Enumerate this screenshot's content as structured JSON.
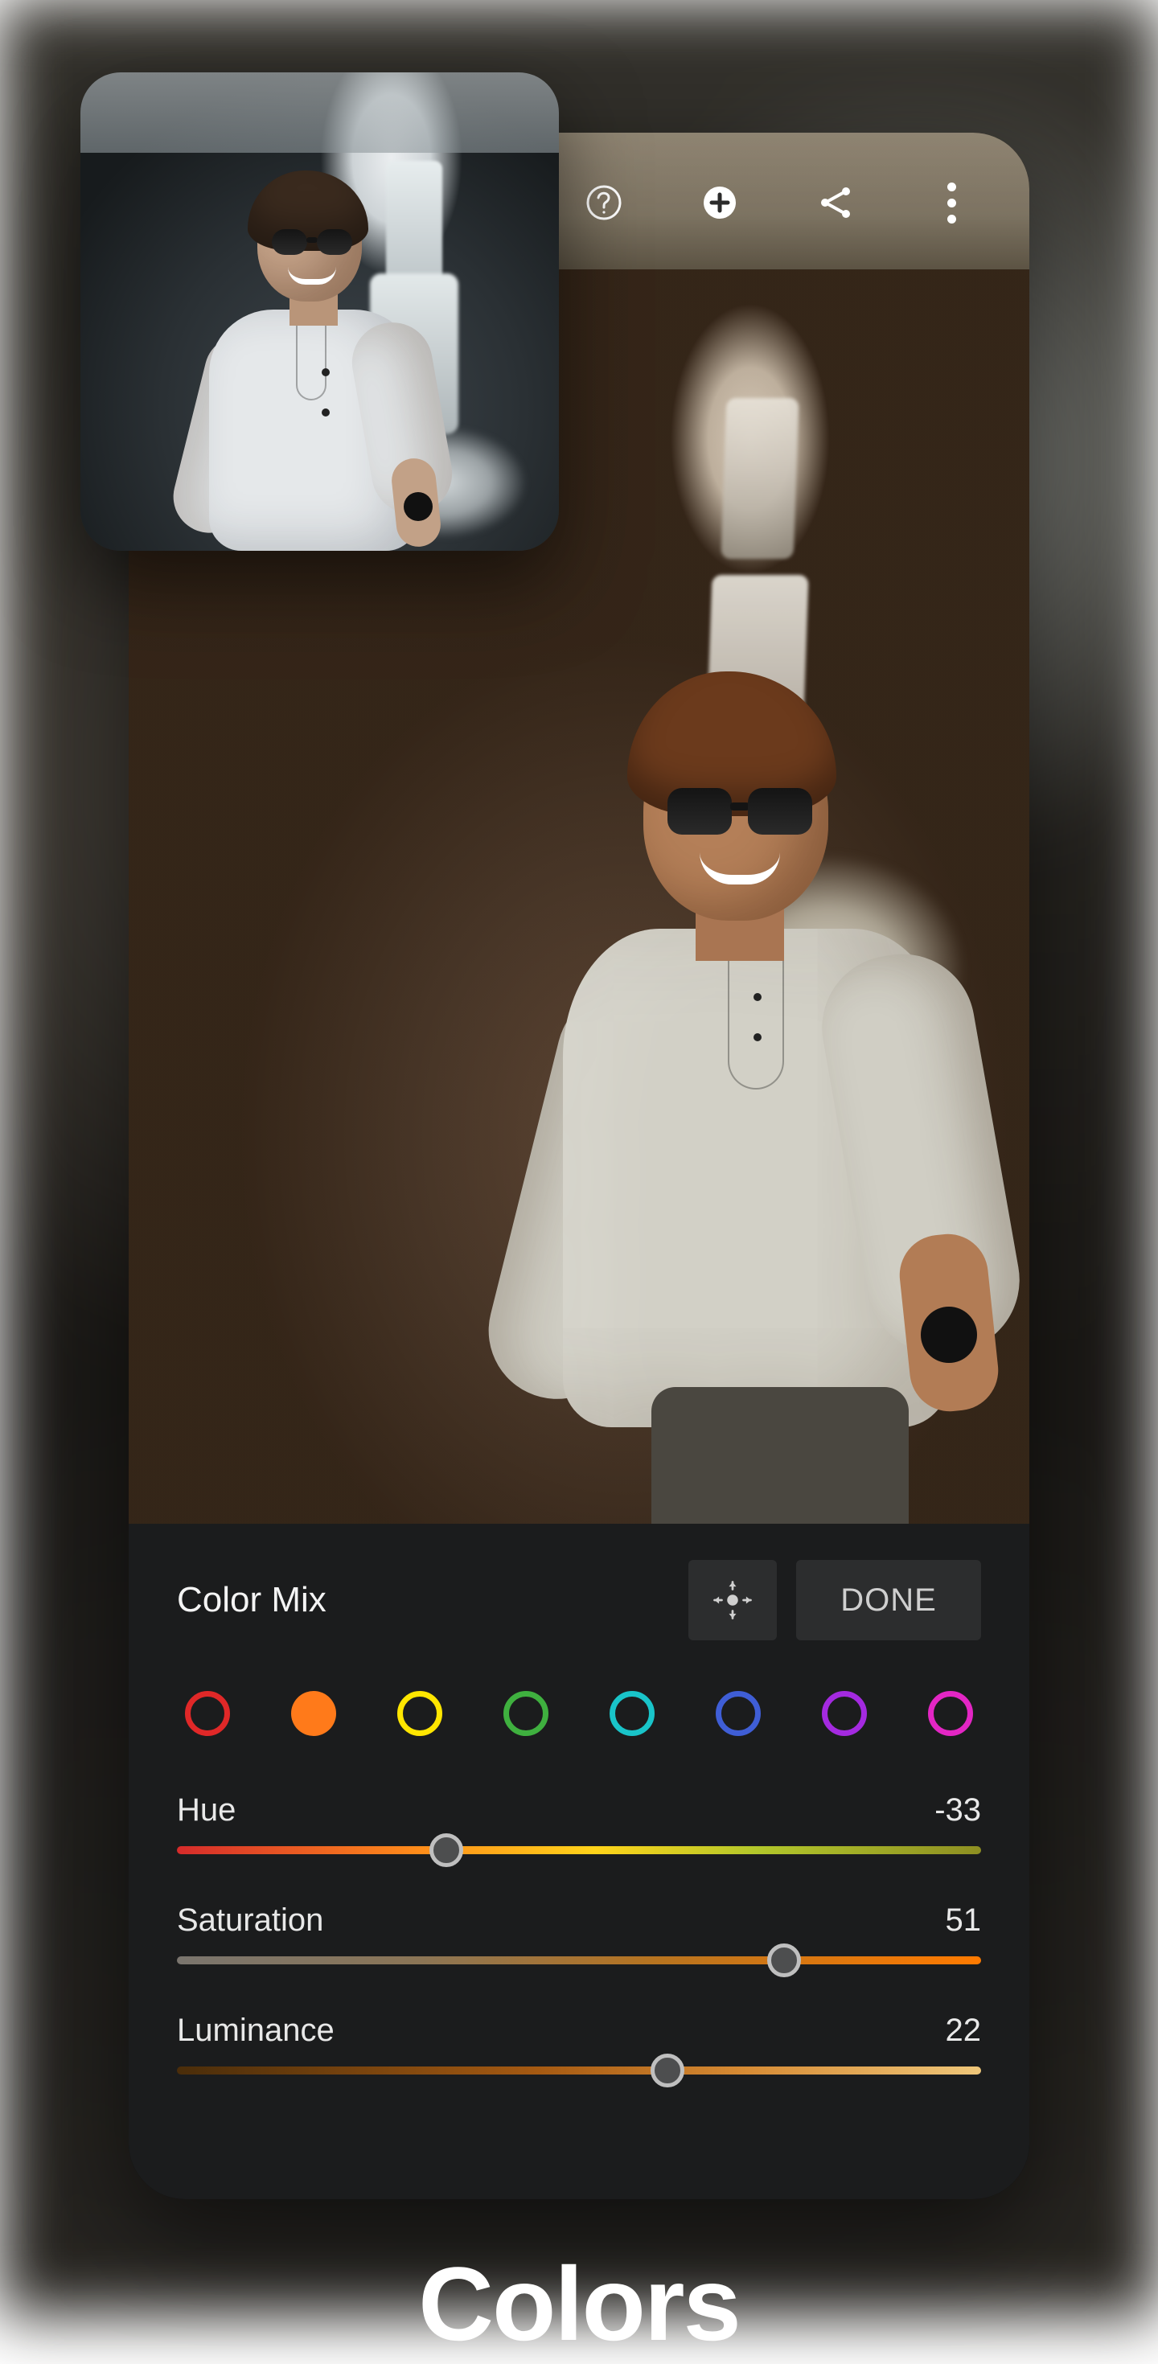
{
  "promo": {
    "title": "Colors"
  },
  "topbar": {
    "icons": [
      "undo-icon",
      "help-icon",
      "add-icon",
      "share-icon",
      "more-icon"
    ]
  },
  "panel": {
    "title": "Color Mix",
    "done_label": "DONE",
    "swatches": [
      {
        "name": "red",
        "color": "#e02828",
        "selected": false
      },
      {
        "name": "orange",
        "color": "#ff7a1a",
        "selected": true
      },
      {
        "name": "yellow",
        "color": "#ffe600",
        "selected": false
      },
      {
        "name": "green",
        "color": "#3fb03f",
        "selected": false
      },
      {
        "name": "aqua",
        "color": "#19c4c9",
        "selected": false
      },
      {
        "name": "blue",
        "color": "#3f5ed6",
        "selected": false
      },
      {
        "name": "purple",
        "color": "#a42ae0",
        "selected": false
      },
      {
        "name": "magenta",
        "color": "#e326c4",
        "selected": false
      }
    ],
    "sliders": {
      "hue": {
        "label": "Hue",
        "value": -33,
        "min": -100,
        "max": 100
      },
      "saturation": {
        "label": "Saturation",
        "value": 51,
        "min": -100,
        "max": 100
      },
      "luminance": {
        "label": "Luminance",
        "value": 22,
        "min": -100,
        "max": 100
      }
    }
  }
}
